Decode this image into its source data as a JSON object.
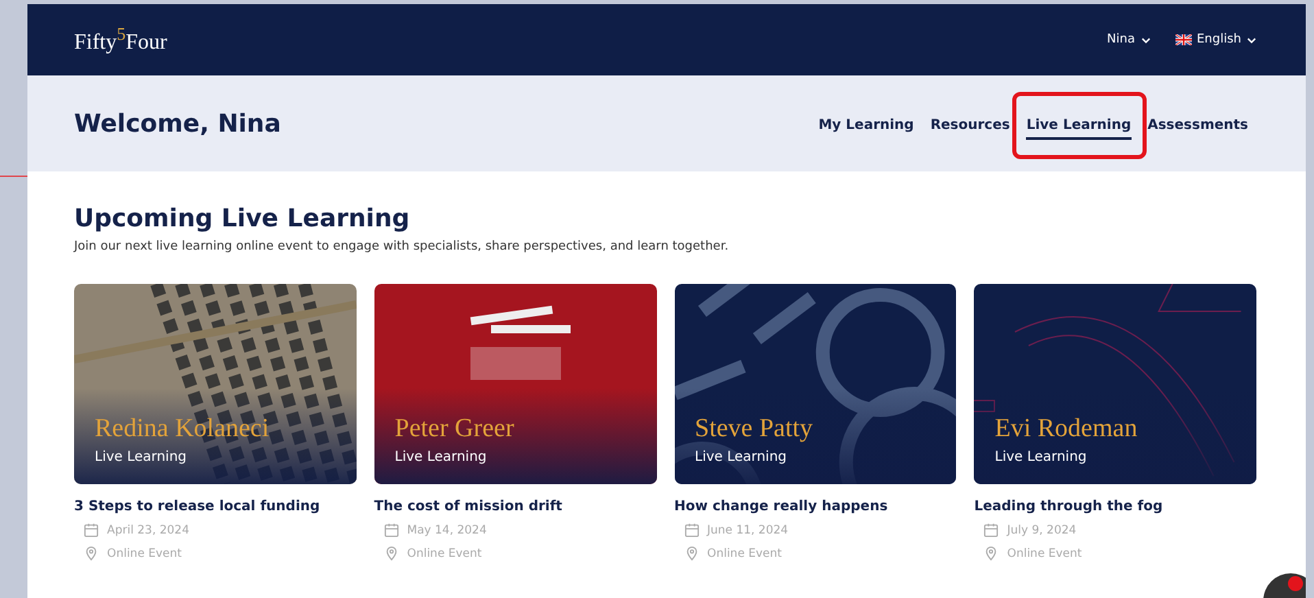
{
  "header": {
    "logo": "Fifty$^{5}$Four",
    "user_menu": "Nina",
    "language_menu": "English"
  },
  "subheader": {
    "greeting": "Welcome, Nina",
    "tabs": [
      {
        "label": "My Learning",
        "selected": false,
        "highlighted": false
      },
      {
        "label": "Resources",
        "selected": false,
        "highlighted": false
      },
      {
        "label": "Live Learning",
        "selected": true,
        "highlighted": true
      },
      {
        "label": "Assessments",
        "selected": false,
        "highlighted": false
      }
    ]
  },
  "section": {
    "title": "Upcoming Live Learning",
    "description": "Join our next live learning online event to engage with specialists, share perspectives, and learn together."
  },
  "events": [
    {
      "kind": "photo",
      "speaker": "Redina Kolaneci",
      "series": "Live Learning",
      "title": "3 Steps to release local funding",
      "date": "April 23, 2024",
      "location": "Online Event"
    },
    {
      "kind": "cover",
      "speaker": "Peter Greer",
      "series": "Live Learning",
      "title": "The cost of mission drift",
      "date": "May 14, 2024",
      "location": "Online Event"
    },
    {
      "kind": "numerals",
      "speaker": "Steve Patty",
      "series": "Live Learning",
      "title": "How change really happens",
      "date": "June 11, 2024",
      "location": "Online Event"
    },
    {
      "kind": "arcs",
      "speaker": "Evi Rodeman",
      "series": "Live Learning",
      "title": "Leading through the fog",
      "date": "July 9, 2024",
      "location": "Online Event"
    }
  ],
  "chat": {
    "unread": true
  }
}
